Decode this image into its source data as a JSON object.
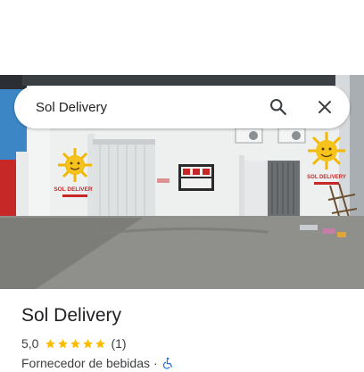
{
  "search": {
    "query": "Sol Delivery"
  },
  "photo": {
    "wall_sign_text": "SOL DELIVERY",
    "accent_colors": {
      "sun": "#f2b705",
      "sign_text": "#c62828",
      "sky": "#3d86c6"
    }
  },
  "place": {
    "name": "Sol Delivery",
    "rating_value": "5,0",
    "stars": 5,
    "review_count": "(1)",
    "category": "Fornecedor de bebidas",
    "separator": "·",
    "extra_icon": "wheelchair-accessible-icon"
  },
  "icons": {
    "search": "search-icon",
    "close": "close-icon",
    "star": "star-icon"
  },
  "colors": {
    "star": "#fbbc04",
    "text_primary": "#202124",
    "text_secondary": "#3c4043",
    "accessibility": "#1a73e8"
  }
}
